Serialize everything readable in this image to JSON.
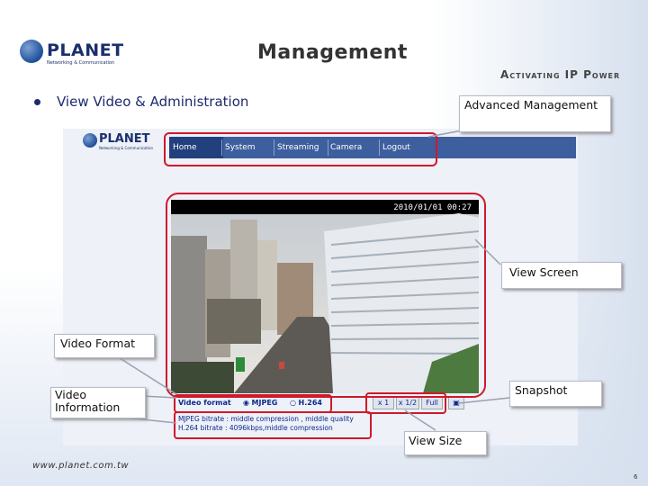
{
  "slide": {
    "title": "Management",
    "slogan": "Activating IP Power",
    "bullet": "View Video & Administration",
    "footer": "www.planet.com.tw",
    "page_number": "6"
  },
  "brand": {
    "name": "PLANET",
    "tagline": "Networking & Communication"
  },
  "callouts": {
    "advanced_management": "Advanced Management",
    "view_screen": "View Screen",
    "video_format": "Video Format",
    "video_information": "Video Information",
    "snapshot": "Snapshot",
    "view_size": "View Size"
  },
  "webpage": {
    "nav": [
      "Home",
      "System",
      "Streaming",
      "Camera",
      "Logout"
    ],
    "active_tab": "Home",
    "timestamp": "2010/01/01 00:27",
    "video_format_label": "Video format",
    "formats": [
      "MJPEG",
      "H.264"
    ],
    "selected_format": "MJPEG",
    "size_buttons": [
      "x 1",
      "x 1/2",
      "Full"
    ],
    "info_lines": [
      "MJPEG bitrate : middle compression , middle quality",
      "H.264 bitrate : 4096kbps,middle compression"
    ]
  },
  "colors": {
    "nav_bg": "#3d5f9e",
    "highlight": "#d0182a",
    "title_text": "#333333",
    "bullet_text": "#1d2a6e"
  }
}
